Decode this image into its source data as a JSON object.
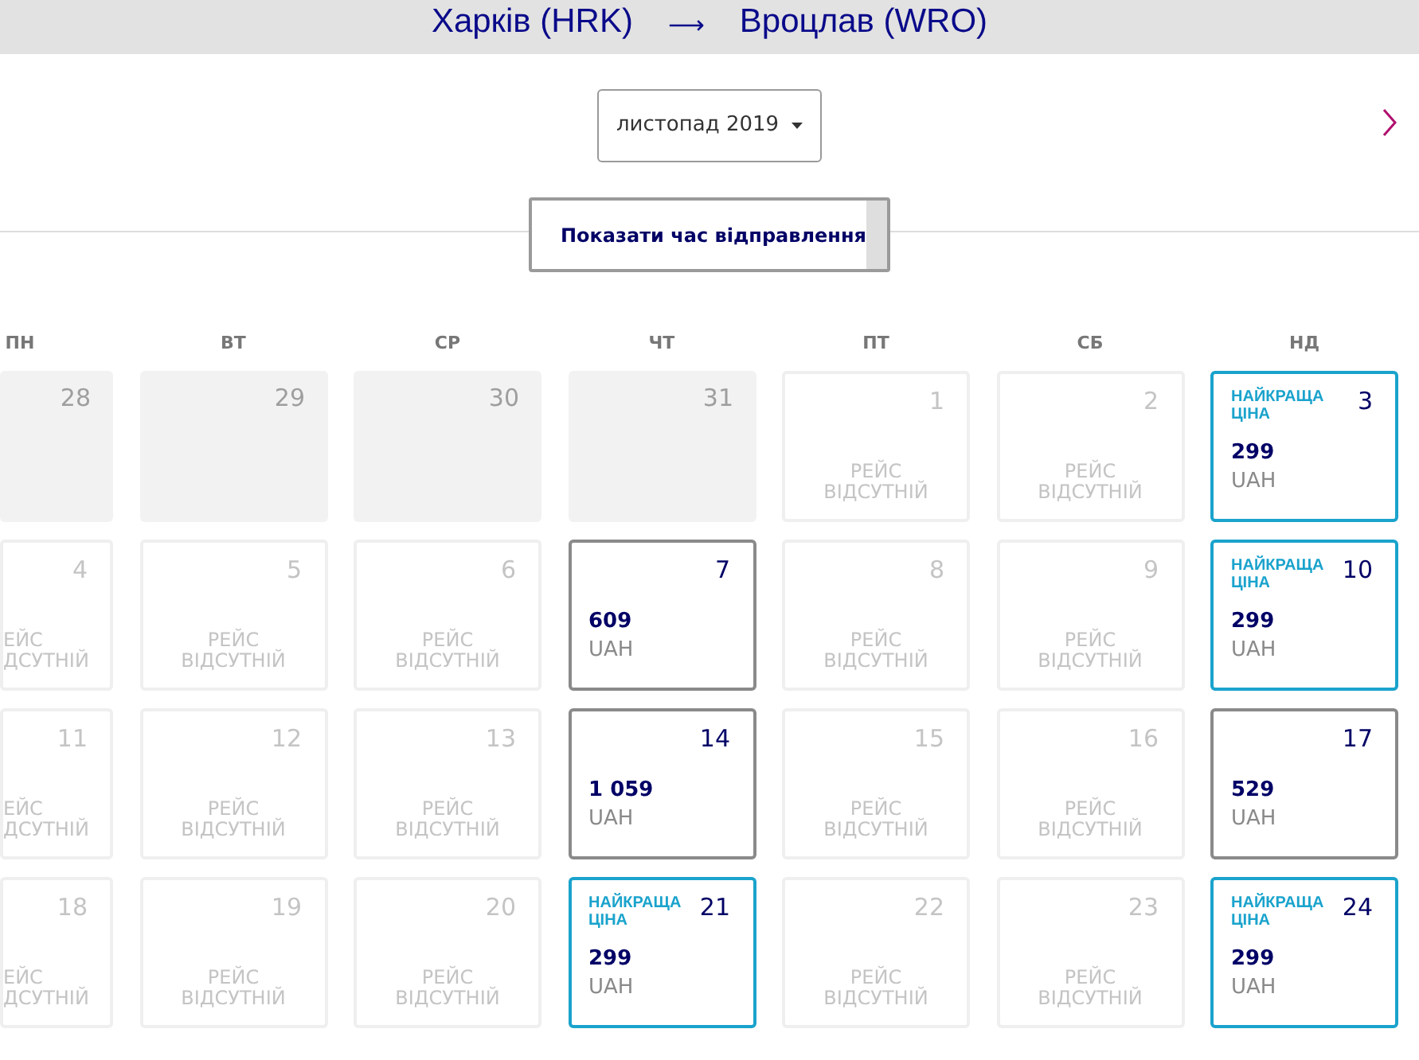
{
  "route": {
    "origin": "Харків (HRK)",
    "arrow": "⟶",
    "destination": "Вроцлав (WRO)"
  },
  "month_select": {
    "value": "листопад 2019"
  },
  "show_times_button": "Показати час відправлення",
  "weekdays": [
    "ПН",
    "ВТ",
    "СР",
    "ЧТ",
    "ПТ",
    "СБ",
    "НД"
  ],
  "weeks": [
    [
      {
        "kind": "past",
        "day": "28"
      },
      {
        "kind": "past",
        "day": "29"
      },
      {
        "kind": "past",
        "day": "30"
      },
      {
        "kind": "past",
        "day": "31"
      },
      {
        "kind": "empty",
        "day": "1",
        "note": "РЕЙС ВІДСУТНІЙ"
      },
      {
        "kind": "empty",
        "day": "2",
        "note": "РЕЙС ВІДСУТНІЙ"
      },
      {
        "kind": "price",
        "day": "3",
        "best": true,
        "badge": "НАЙКРАЩА ЦІНА",
        "price": "299",
        "currency": "UAH"
      }
    ],
    [
      {
        "kind": "empty",
        "day": "4",
        "note": "ЕЙС ДСУТНІЙ"
      },
      {
        "kind": "empty",
        "day": "5",
        "note": "РЕЙС ВІДСУТНІЙ"
      },
      {
        "kind": "empty",
        "day": "6",
        "note": "РЕЙС ВІДСУТНІЙ"
      },
      {
        "kind": "price",
        "day": "7",
        "best": false,
        "price": "609",
        "currency": "UAH"
      },
      {
        "kind": "empty",
        "day": "8",
        "note": "РЕЙС ВІДСУТНІЙ"
      },
      {
        "kind": "empty",
        "day": "9",
        "note": "РЕЙС ВІДСУТНІЙ"
      },
      {
        "kind": "price",
        "day": "10",
        "best": true,
        "badge": "НАЙКРАЩА ЦІНА",
        "price": "299",
        "currency": "UAH"
      }
    ],
    [
      {
        "kind": "empty",
        "day": "11",
        "note": "ЕЙС ДСУТНІЙ"
      },
      {
        "kind": "empty",
        "day": "12",
        "note": "РЕЙС ВІДСУТНІЙ"
      },
      {
        "kind": "empty",
        "day": "13",
        "note": "РЕЙС ВІДСУТНІЙ"
      },
      {
        "kind": "price",
        "day": "14",
        "best": false,
        "price": "1 059",
        "currency": "UAH"
      },
      {
        "kind": "empty",
        "day": "15",
        "note": "РЕЙС ВІДСУТНІЙ"
      },
      {
        "kind": "empty",
        "day": "16",
        "note": "РЕЙС ВІДСУТНІЙ"
      },
      {
        "kind": "price",
        "day": "17",
        "best": false,
        "price": "529",
        "currency": "UAH"
      }
    ],
    [
      {
        "kind": "empty",
        "day": "18",
        "note": "ЕЙС ДСУТНІЙ"
      },
      {
        "kind": "empty",
        "day": "19",
        "note": "РЕЙС ВІДСУТНІЙ"
      },
      {
        "kind": "empty",
        "day": "20",
        "note": "РЕЙС ВІДСУТНІЙ"
      },
      {
        "kind": "price",
        "day": "21",
        "best": true,
        "badge": "НАЙКРАЩА ЦІНА",
        "price": "299",
        "currency": "UAH"
      },
      {
        "kind": "empty",
        "day": "22",
        "note": "РЕЙС ВІДСУТНІЙ"
      },
      {
        "kind": "empty",
        "day": "23",
        "note": "РЕЙС ВІДСУТНІЙ"
      },
      {
        "kind": "price",
        "day": "24",
        "best": true,
        "badge": "НАЙКРАЩА ЦІНА",
        "price": "299",
        "currency": "UAH"
      }
    ]
  ]
}
